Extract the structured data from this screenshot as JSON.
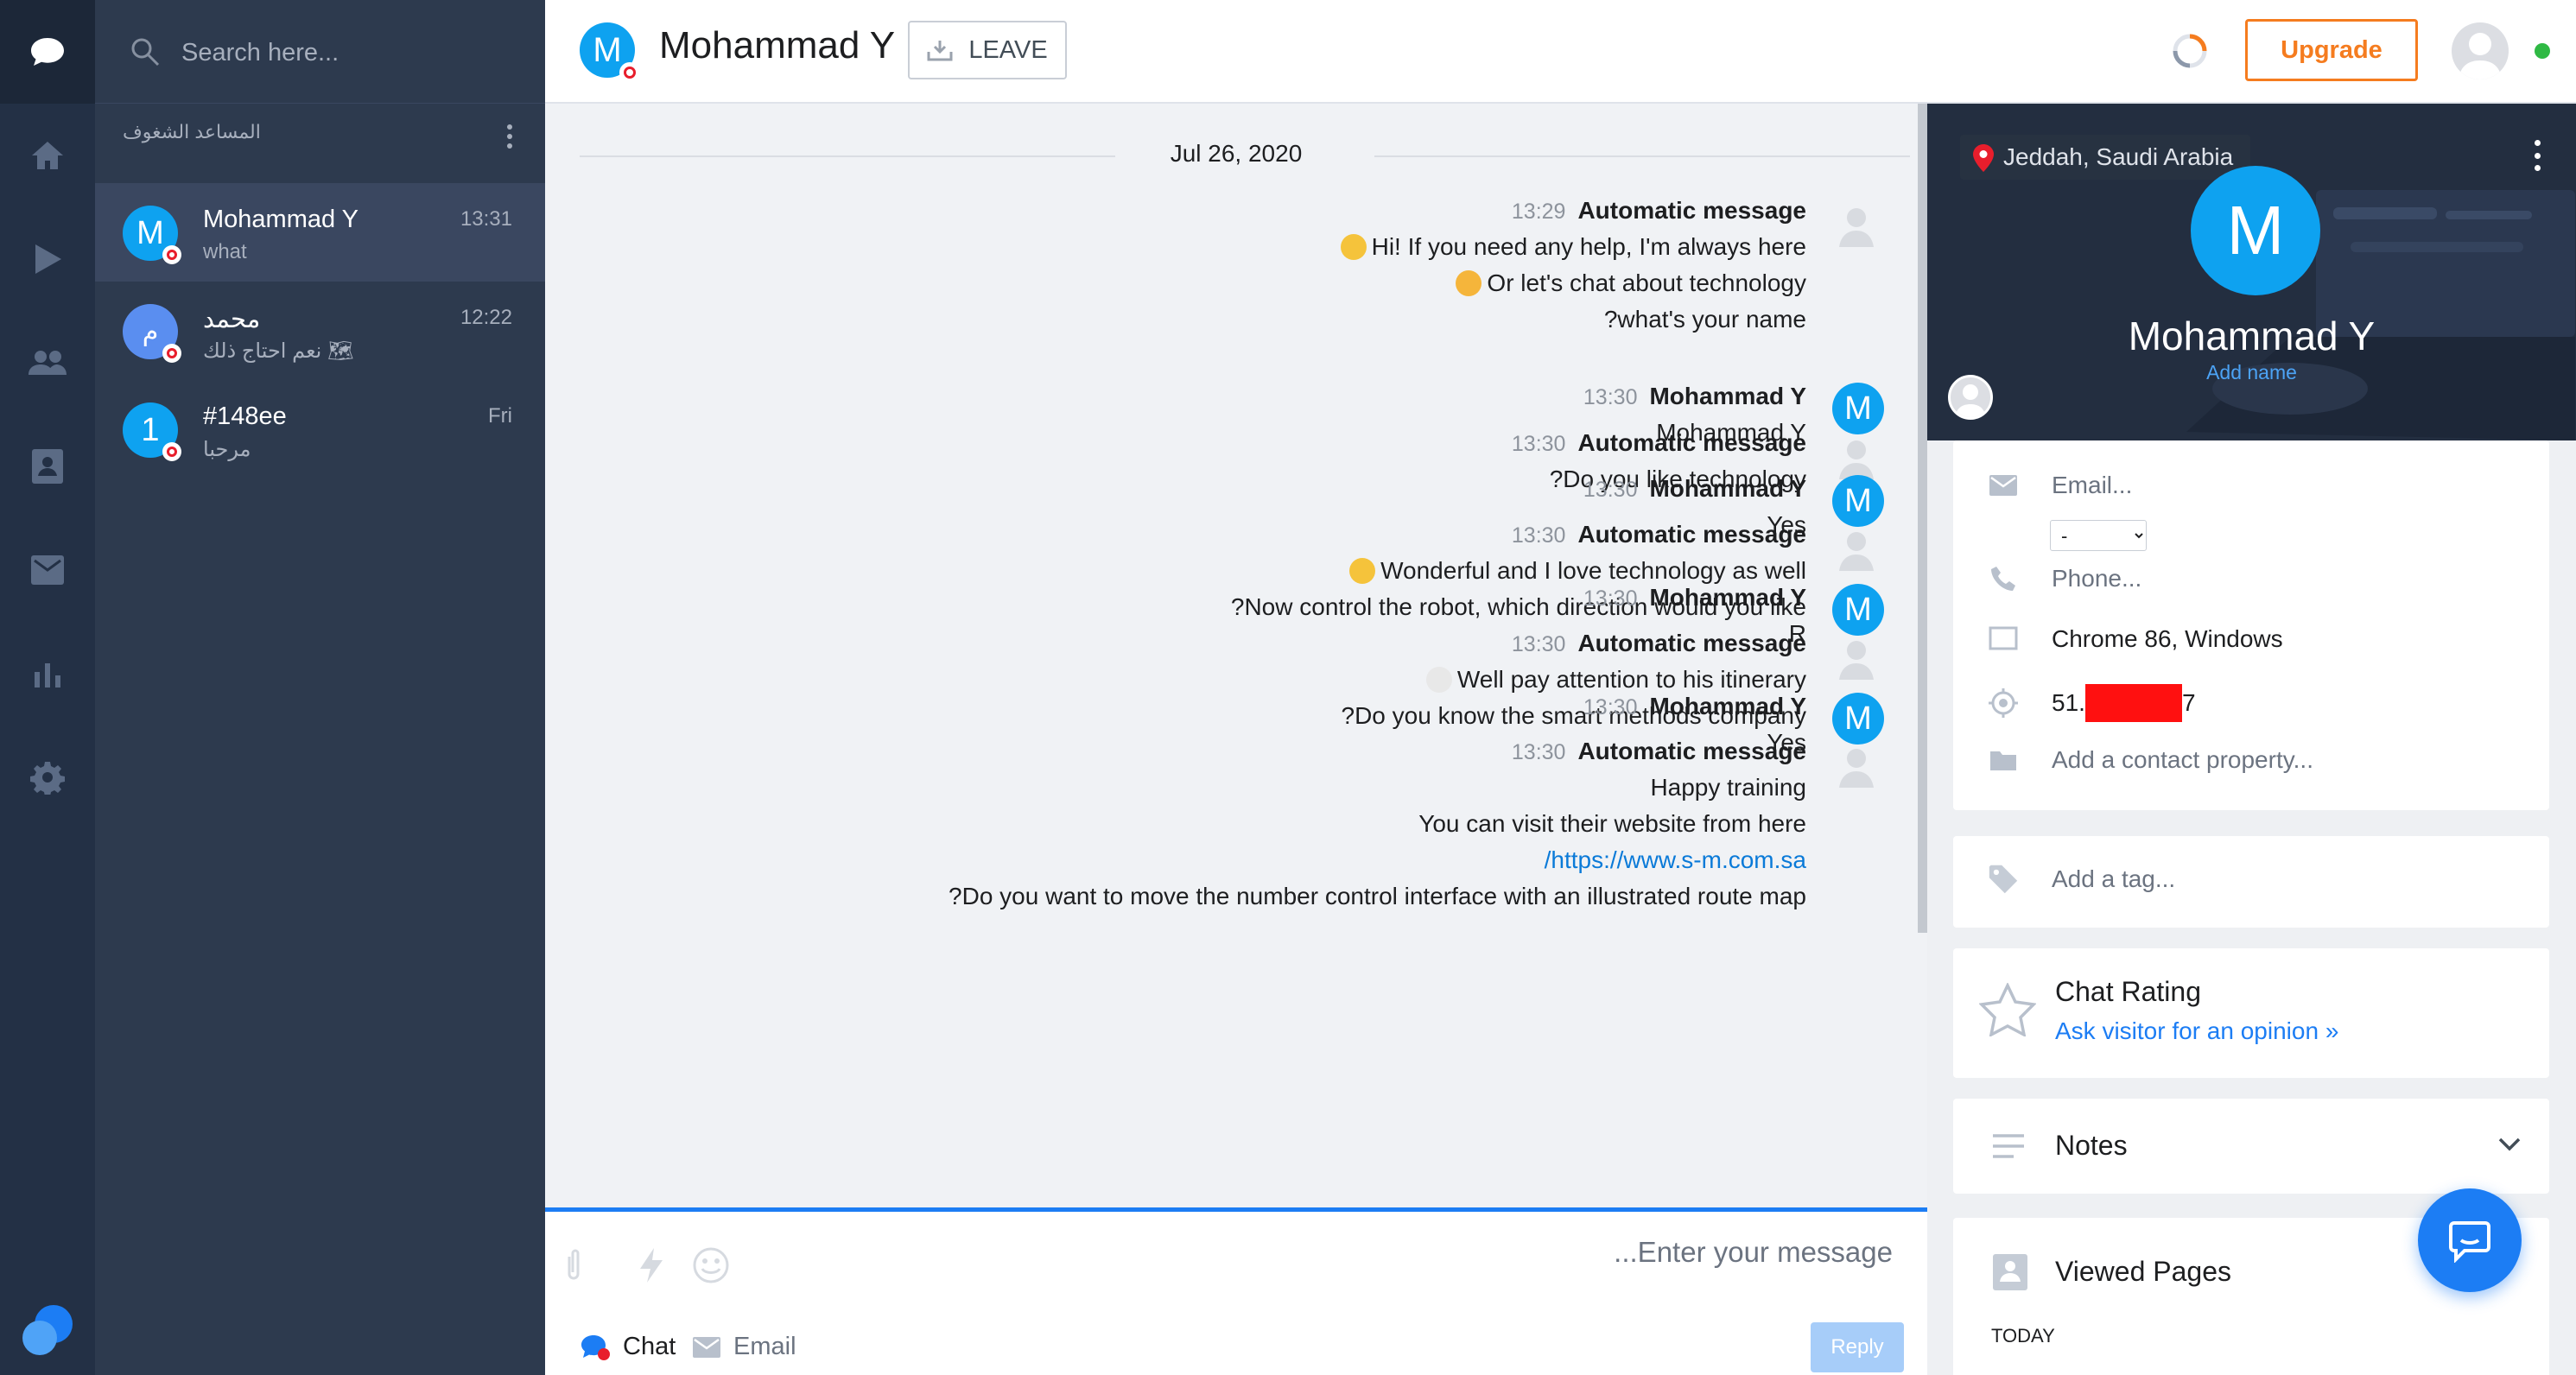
{
  "nav": {
    "items": [
      "chats-icon",
      "home-icon",
      "play-icon",
      "visitors-icon",
      "contacts-icon",
      "inbox-icon",
      "reports-icon",
      "settings-icon"
    ],
    "logo": "brand-logo-icon"
  },
  "search": {
    "placeholder": "Search here..."
  },
  "conv_group": {
    "label": "المساعد الشغوف"
  },
  "conversations": [
    {
      "initial": "M",
      "name": "Mohammad Y",
      "preview": "what",
      "time": "13:31",
      "color": "#0ea2f0"
    },
    {
      "initial": "م",
      "name": "محمد",
      "preview": "نعم احتاج ذلك 🗺",
      "time": "12:22",
      "color": "#5a8ef0"
    },
    {
      "initial": "1",
      "name": "#148ee",
      "preview": "مرحبا",
      "time": "Fri",
      "color": "#0ea2f0"
    }
  ],
  "header": {
    "initial": "M",
    "title": "Mohammad Y",
    "leave_label": "LEAVE",
    "upgrade_label": "Upgrade"
  },
  "chat": {
    "date": "Jul 26, 2020",
    "messages": [
      {
        "time": "13:29",
        "author": "Automatic message",
        "lines": [
          "Hi! If you need any help, I'm always here",
          "Or let's chat about technology",
          "?what's your name"
        ]
      },
      {
        "time": "13:30",
        "author": "Mohammad Y",
        "lines": [
          "Mohammad Y"
        ]
      },
      {
        "time": "13:30",
        "author": "Automatic message",
        "lines": [
          "?Do you like technology"
        ]
      },
      {
        "time": "13:30",
        "author": "Mohammad Y",
        "lines": [
          "Yes"
        ]
      },
      {
        "time": "13:30",
        "author": "Automatic message",
        "lines": [
          "Wonderful and I love technology as well",
          "?Now control the robot, which direction would you like"
        ]
      },
      {
        "time": "13:30",
        "author": "Mohammad Y",
        "lines": [
          "R"
        ]
      },
      {
        "time": "13:30",
        "author": "Automatic message",
        "lines": [
          "Well pay attention to his itinerary",
          "?Do you know the smart methods company"
        ]
      },
      {
        "time": "13:30",
        "author": "Mohammad Y",
        "lines": [
          "Yes"
        ]
      },
      {
        "time": "13:30",
        "author": "Automatic message",
        "lines": [
          "Happy training",
          "You can visit their website from here",
          "/https://www.s-m.com.sa",
          "?Do you want to move the number control interface with an illustrated route map"
        ]
      }
    ],
    "avatar_initial": "M"
  },
  "composer": {
    "placeholder": "...Enter your message",
    "chat_tab": "Chat",
    "email_tab": "Email",
    "reply_label": "Reply"
  },
  "profile": {
    "location": "Jeddah, Saudi Arabia",
    "initial": "M",
    "name": "Mohammad Y",
    "add_name": "Add name",
    "email_placeholder": "Email...",
    "select_value": "-",
    "phone_placeholder": "Phone...",
    "browser": "Chrome 86, Windows",
    "ip_prefix": "51.",
    "ip_suffix": "7",
    "add_property": "Add a contact property...",
    "tag_placeholder": "Add a tag...",
    "rating_title": "Chat Rating",
    "rating_link": "Ask visitor for an opinion »",
    "notes_title": "Notes",
    "viewed_title": "Viewed Pages",
    "viewed_today": "TODAY"
  },
  "colors": {
    "accent": "#1c7df4",
    "avatar": "#0ea2f0",
    "upgrade": "#f57c1f",
    "online": "#2fb944",
    "rail": "#233045",
    "list": "#2d3a4e"
  }
}
